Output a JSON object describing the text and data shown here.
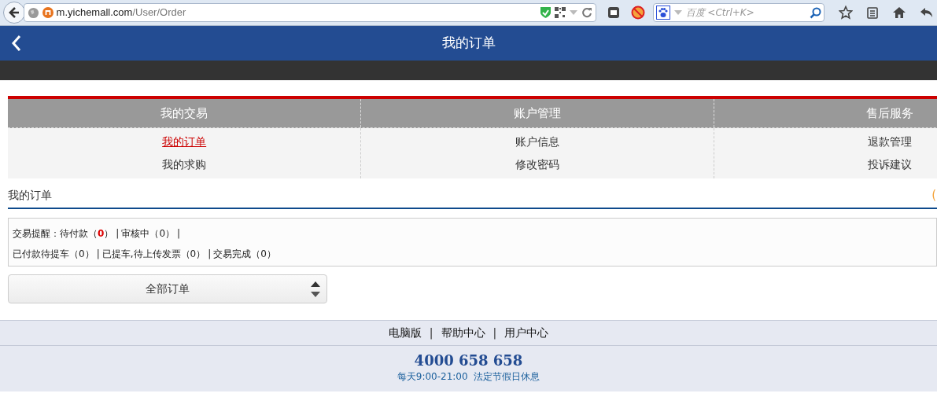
{
  "browser": {
    "url_host": "m.yichemall.com",
    "url_path": "/User/Order",
    "search_placeholder": "百度 <Ctrl+K>"
  },
  "header": {
    "title": "我的订单"
  },
  "menu": [
    {
      "heading": "我的交易",
      "links": [
        {
          "label": "我的订单",
          "selected": true
        },
        {
          "label": "我的求购",
          "selected": false
        }
      ]
    },
    {
      "heading": "账户管理",
      "links": [
        {
          "label": "账户信息",
          "selected": false
        },
        {
          "label": "修改密码",
          "selected": false
        }
      ]
    },
    {
      "heading": "售后服务",
      "links": [
        {
          "label": "退款管理",
          "selected": false
        },
        {
          "label": "投诉建议",
          "selected": false
        }
      ]
    }
  ],
  "section": {
    "title": "我的订单",
    "edge_mark": "("
  },
  "reminders": {
    "prefix": "交易提醒：",
    "lines": [
      [
        {
          "label": "待付款（",
          "count": "0",
          "close": "）",
          "alert": true,
          "separator": "|"
        },
        {
          "label": "审核中（",
          "count": "0",
          "close": "）",
          "alert": false,
          "separator": "|"
        }
      ],
      [
        {
          "label": "已付款待提车（",
          "count": "0",
          "close": "）",
          "alert": false,
          "separator": "|"
        },
        {
          "label": "已提车,待上传发票（",
          "count": "0",
          "close": "）",
          "alert": false,
          "separator": "|"
        },
        {
          "label": "交易完成（",
          "count": "0",
          "close": "）",
          "alert": false
        }
      ]
    ]
  },
  "filter": {
    "value": "全部订单"
  },
  "footer": {
    "links": [
      "电脑版",
      "帮助中心",
      "用户中心"
    ],
    "separator": "|",
    "phone": "4000 658 658",
    "hours": "每天9:00-21:00  法定节假日休息"
  }
}
